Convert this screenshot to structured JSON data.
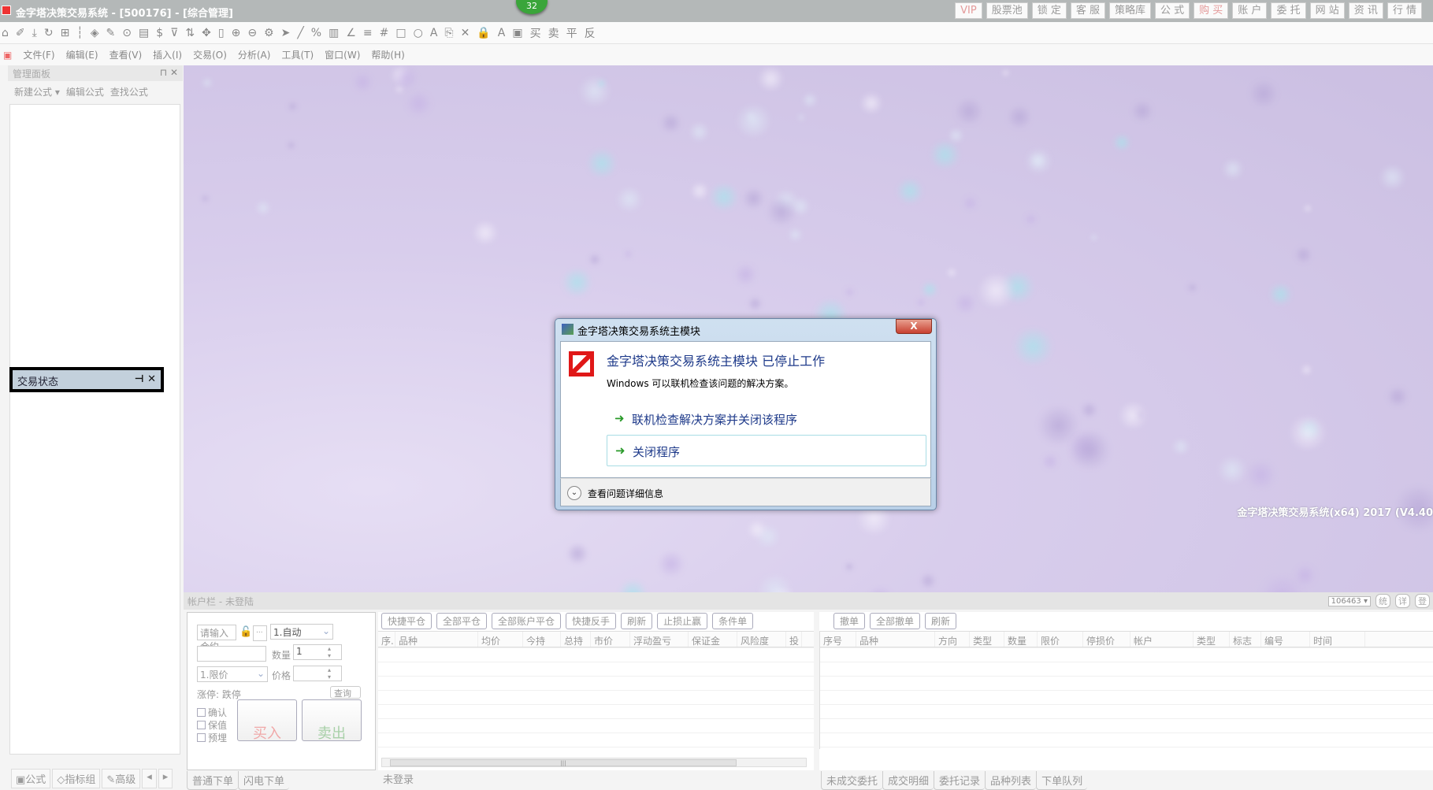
{
  "window": {
    "title": "金字塔决策交易系统 - [500176] - [综合管理]",
    "notification_count": "32"
  },
  "top_buttons": [
    {
      "label": "VIP",
      "accent": true
    },
    {
      "label": "股票池"
    },
    {
      "label": "锁 定"
    },
    {
      "label": "客 服"
    },
    {
      "label": "策略库"
    },
    {
      "label": "公 式"
    },
    {
      "label": "购 买",
      "accent": true
    },
    {
      "label": "账 户"
    },
    {
      "label": "委 托"
    },
    {
      "label": "网 站"
    },
    {
      "label": "资 讯"
    },
    {
      "label": "行 情"
    }
  ],
  "toolbar_icons": [
    "home-icon",
    "pencil-icon",
    "download-icon",
    "refresh-icon",
    "grid-icon",
    "candlestick-icon",
    "diamond-icon",
    "edit-icon",
    "play-icon",
    "document-icon",
    "dollar-icon",
    "filter-icon",
    "swap-icon",
    "move-icon",
    "column-icon",
    "zoom-in-icon",
    "zoom-out-icon",
    "gear-icon",
    "cursor-icon",
    "line-icon",
    "percent-icon",
    "bars-icon",
    "angle-icon",
    "list-icon",
    "hash-icon",
    "rectangle-icon",
    "circle-icon",
    "text-icon",
    "copy-icon",
    "delete-icon",
    "lock-icon",
    "font-color-icon",
    "save-icon"
  ],
  "toolbar_text_buttons": [
    "买",
    "卖",
    "平",
    "反"
  ],
  "menu": [
    "文件(F)",
    "编辑(E)",
    "查看(V)",
    "插入(I)",
    "交易(O)",
    "分析(A)",
    "工具(T)",
    "窗口(W)",
    "帮助(H)"
  ],
  "left_panel": {
    "title": "管理面板",
    "tools": [
      "新建公式 ▾",
      "编辑公式",
      "查找公式"
    ],
    "floating_title": "交易状态",
    "tabs": [
      "公式",
      "指标组",
      "高级"
    ]
  },
  "watermark": "金字塔决策交易系统(x64) 2017 (V4.40",
  "dialog": {
    "title": "金字塔决策交易系统主模块",
    "heading": "金字塔决策交易系统主模块 已停止工作",
    "message": "Windows 可以联机检查该问题的解决方案。",
    "options": [
      "联机检查解决方案并关闭该程序",
      "关闭程序"
    ],
    "details": "查看问题详细信息",
    "close": "X"
  },
  "account_bar": {
    "title": "帐户栏 - 未登陆",
    "account": "106463",
    "buttons": [
      "统",
      "详",
      "登"
    ]
  },
  "order_form": {
    "contract_placeholder": "请输入合约",
    "more": "...",
    "mode": "1.自动",
    "qty_label": "数量",
    "qty": "1",
    "price_type": "1.限价",
    "price_label": "价格",
    "limits": "涨停: 跌停",
    "query": "查询",
    "checks": [
      "确认",
      "保值",
      "预埋"
    ],
    "buy": "买入",
    "sell": "卖出",
    "tabs": [
      "普通下单",
      "闪电下单"
    ]
  },
  "positions": {
    "buttons": [
      "快捷平仓",
      "全部平仓",
      "全部账户平仓",
      "快捷反手",
      "刷新",
      "止损止赢",
      "条件单"
    ],
    "columns": [
      "序.",
      "品种",
      "均价",
      "今持",
      "总持",
      "市价",
      "浮动盈亏",
      "保证金",
      "风险度",
      "投"
    ],
    "status": "未登录"
  },
  "orders": {
    "buttons": [
      "撤单",
      "全部撤单",
      "刷新"
    ],
    "columns": [
      "序号",
      "品种",
      "方向",
      "类型",
      "数量",
      "限价",
      "停损价",
      "帐户",
      "类型",
      "标志",
      "编号",
      "时间"
    ],
    "tabs": [
      "未成交委托",
      "成交明细",
      "委托记录",
      "品种列表",
      "下单队列"
    ]
  }
}
